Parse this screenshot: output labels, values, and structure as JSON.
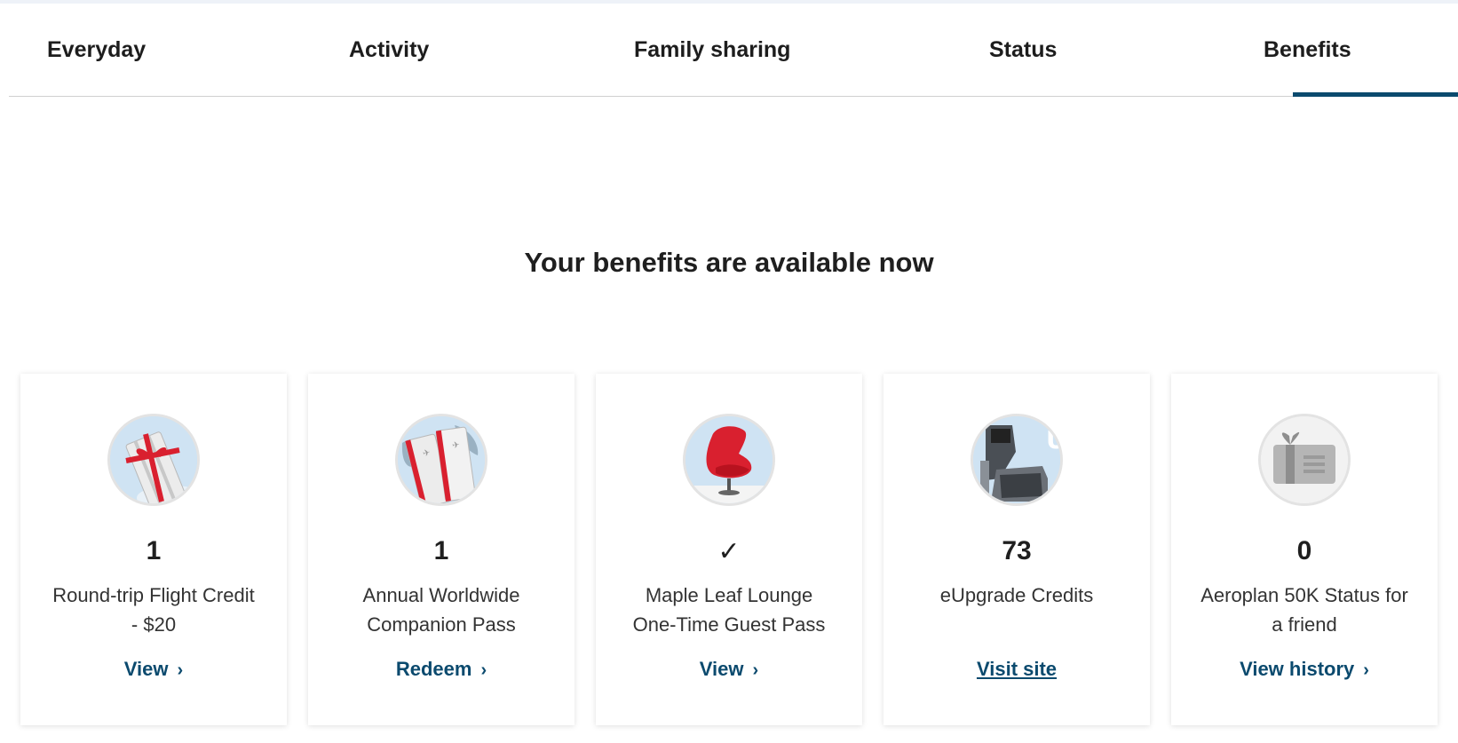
{
  "tabs": [
    {
      "label": "Everyday"
    },
    {
      "label": "Activity"
    },
    {
      "label": "Family sharing"
    },
    {
      "label": "Status"
    },
    {
      "label": "Benefits",
      "active": true
    }
  ],
  "heading": "Your benefits are available now",
  "cards": [
    {
      "icon": "gift-ticket-icon",
      "value": "1",
      "label": "Round-trip Flight Credit - $20",
      "action": "View",
      "action_icon": "chevron-right-icon"
    },
    {
      "icon": "companion-tickets-icon",
      "value": "1",
      "label": "Annual Worldwide Companion Pass",
      "action": "Redeem",
      "action_icon": "chevron-right-icon"
    },
    {
      "icon": "lounge-chair-icon",
      "value": "✓",
      "label": "Maple Leaf Lounge One-Time Guest Pass",
      "action": "View",
      "action_icon": "chevron-right-icon"
    },
    {
      "icon": "business-seat-icon",
      "value": "73",
      "label": "eUpgrade Credits",
      "action": "Visit site"
    },
    {
      "icon": "status-gift-card-icon",
      "value": "0",
      "label": "Aeroplan 50K Status for a friend",
      "action": "View history",
      "action_icon": "chevron-right-icon"
    }
  ],
  "colors": {
    "accent": "#0b4a6e",
    "lounge_red": "#d9202f"
  }
}
